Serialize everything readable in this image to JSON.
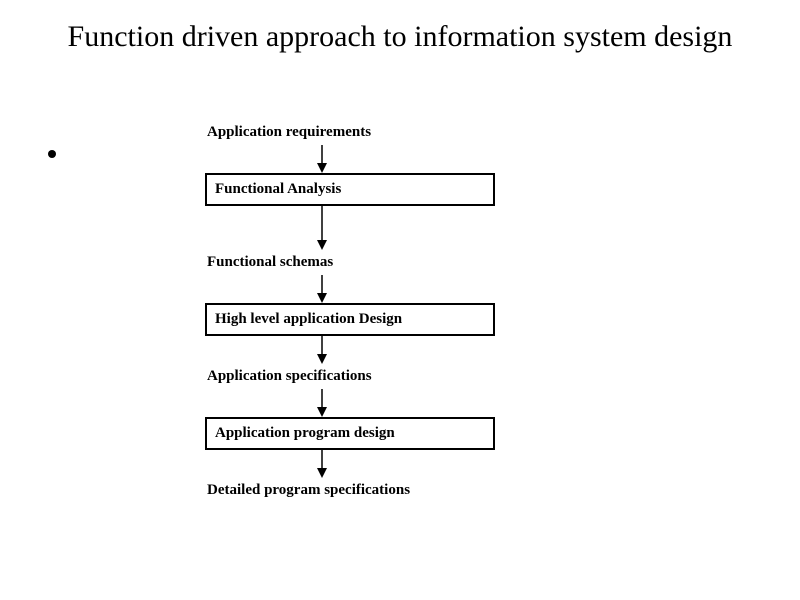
{
  "title": "Function driven approach to information system design",
  "steps": {
    "label1": "Application requirements",
    "box1": "Functional Analysis",
    "label2": "Functional schemas",
    "box2": "High level application Design",
    "label3": "Application specifications",
    "box3": "Application program design",
    "label4": "Detailed program specifications"
  }
}
